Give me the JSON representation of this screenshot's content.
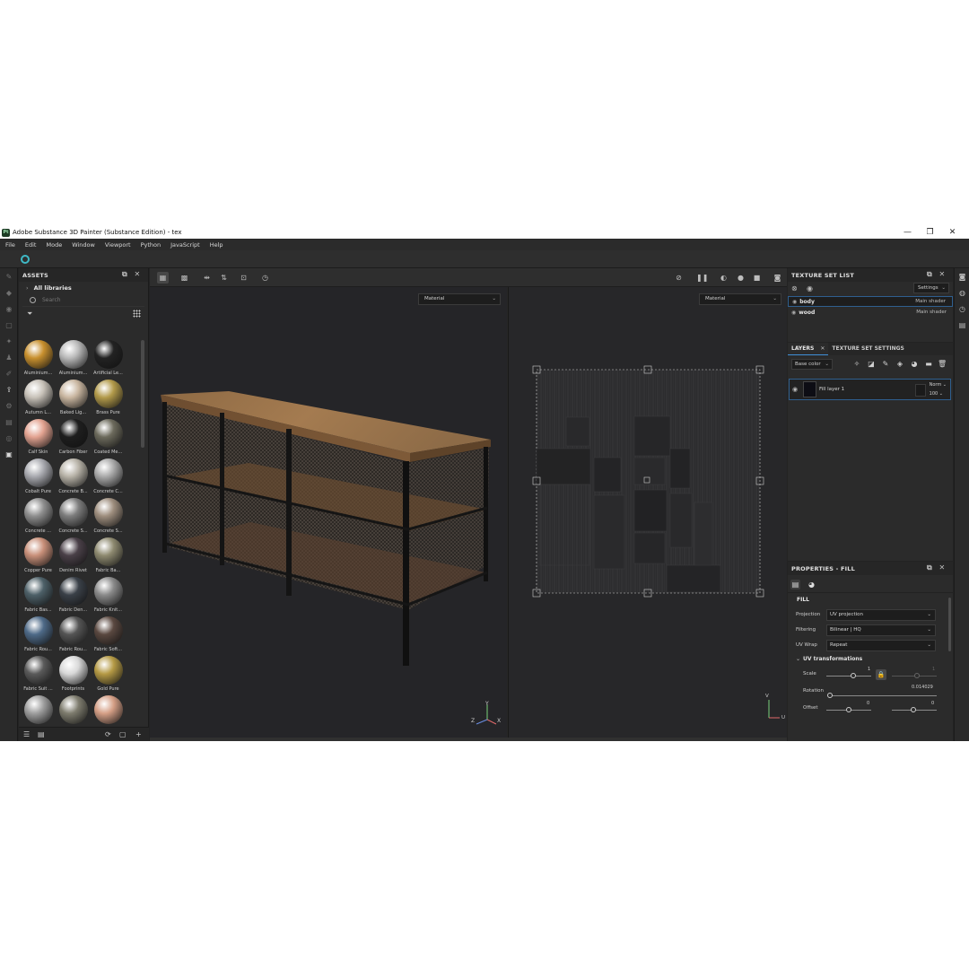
{
  "window": {
    "title": "Adobe Substance 3D Painter (Substance Edition) - tex",
    "logo_text": "Pt",
    "controls": [
      "—",
      "❐",
      "✕"
    ]
  },
  "menu": [
    "File",
    "Edit",
    "Mode",
    "Window",
    "Viewport",
    "Python",
    "JavaScript",
    "Help"
  ],
  "assets": {
    "header": "ASSETS",
    "library": "All libraries",
    "search_placeholder": "Search",
    "items": [
      {
        "label": "Aluminium...",
        "color": "#c8902e"
      },
      {
        "label": "Aluminium...",
        "color": "#b9b9b9"
      },
      {
        "label": "Artificial Le...",
        "color": "#222222"
      },
      {
        "label": "Autumn L...",
        "color": "#c7c1b8"
      },
      {
        "label": "Baked Lig...",
        "color": "#c9b6a0"
      },
      {
        "label": "Brass Pure",
        "color": "#b29a4a"
      },
      {
        "label": "Calf Skin",
        "color": "#e3a391"
      },
      {
        "label": "Carbon Fiber",
        "color": "#1e1e1e"
      },
      {
        "label": "Coated Me...",
        "color": "#6c6a5c"
      },
      {
        "label": "Cobalt Pure",
        "color": "#a9aab0"
      },
      {
        "label": "Concrete B...",
        "color": "#b8b3a8"
      },
      {
        "label": "Concrete C...",
        "color": "#aaaaaa"
      },
      {
        "label": "Concrete ...",
        "color": "#8f8f8f"
      },
      {
        "label": "Concrete S...",
        "color": "#7d7d7d"
      },
      {
        "label": "Concrete S...",
        "color": "#9e8e7e"
      },
      {
        "label": "Copper Pure",
        "color": "#c9907a"
      },
      {
        "label": "Denim Rivet",
        "color": "#4a4048"
      },
      {
        "label": "Fabric Ba...",
        "color": "#8e8a70"
      },
      {
        "label": "Fabric Bas...",
        "color": "#4d6068"
      },
      {
        "label": "Fabric Den...",
        "color": "#3a4048"
      },
      {
        "label": "Fabric Knit...",
        "color": "#8a8a8a"
      },
      {
        "label": "Fabric Rou...",
        "color": "#4e6a88"
      },
      {
        "label": "Fabric Rou...",
        "color": "#555555"
      },
      {
        "label": "Fabric Soft...",
        "color": "#5a4840"
      },
      {
        "label": "Fabric Suit ...",
        "color": "#5a5a5a"
      },
      {
        "label": "Footprints",
        "color": "#d8d8d8"
      },
      {
        "label": "Gold Pure",
        "color": "#b59a45"
      },
      {
        "label": "",
        "color": "#9e9e9e"
      },
      {
        "label": "",
        "color": "#7e7c6e"
      },
      {
        "label": "",
        "color": "#d59f86"
      }
    ]
  },
  "viewport": {
    "left_mode": "Material",
    "right_mode": "Material",
    "gizmo_3d": [
      "Y",
      "Z",
      "X"
    ],
    "gizmo_2d": [
      "V",
      "U"
    ]
  },
  "texture_set_list": {
    "header": "TEXTURE SET LIST",
    "settings_label": "Settings",
    "rows": [
      {
        "name": "body",
        "shader": "Main shader"
      },
      {
        "name": "wood",
        "shader": "Main shader"
      }
    ]
  },
  "layers": {
    "tab_layers": "LAYERS",
    "tab_settings": "TEXTURE SET SETTINGS",
    "channel": "Base color",
    "layer_name": "Fill layer 1",
    "blend": "Norm",
    "opacity": "100"
  },
  "properties": {
    "header": "PROPERTIES - FILL",
    "section": "FILL",
    "projection_label": "Projection",
    "projection_value": "UV projection",
    "filtering_label": "Filtering",
    "filtering_value": "Bilinear | HQ",
    "uvwrap_label": "UV Wrap",
    "uvwrap_value": "Repeat",
    "uvt_title": "UV transformations",
    "scale_label": "Scale",
    "scale_value": "1",
    "scale_value_2": "1",
    "rotation_label": "Rotation",
    "rotation_value": "0.014029",
    "offset_label": "Offset",
    "offset_x": "0",
    "offset_y": "0"
  }
}
